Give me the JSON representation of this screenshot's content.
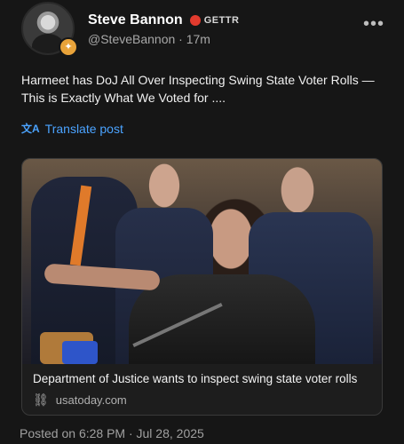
{
  "author": {
    "name": "Steve Bannon",
    "platform": "GETTR",
    "handle": "@SteveBannon",
    "time_ago": "17m",
    "handle_separator": "·"
  },
  "icons": {
    "more": "more-horizontal-icon",
    "translate": "translate-icon",
    "link": "link-icon",
    "verified": "verified-badge-icon",
    "gettr": "gettr-logo-icon"
  },
  "post": {
    "text": "Harmeet has DoJ All Over Inspecting Swing State Voter Rolls — This is Exactly What We Voted for ....",
    "translate_label": "Translate post"
  },
  "card": {
    "caption": "Department of Justice wants to inspect swing state voter rolls",
    "source": "usatoday.com"
  },
  "footer": {
    "posted": "Posted on 6:28 PM · Jul 28, 2025"
  },
  "colors": {
    "background": "#161616",
    "link_blue": "#4ba3ff",
    "gettr_red": "#e23b2e",
    "badge_gold": "#e8a33a"
  }
}
